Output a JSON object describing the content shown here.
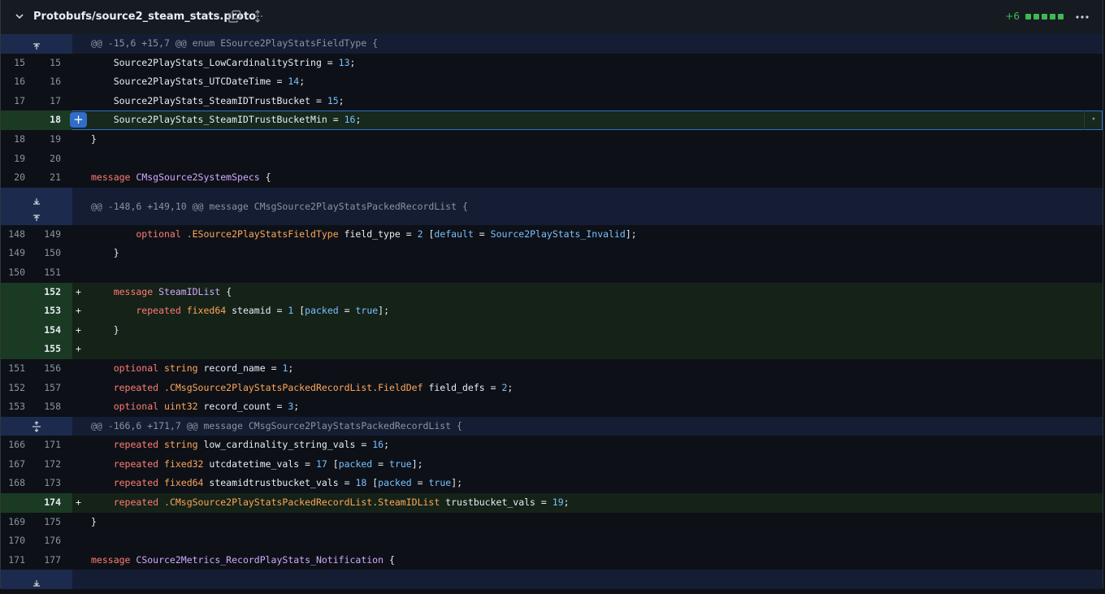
{
  "file": {
    "path": "Protobufs/source2_steam_stats.proto",
    "diffstat": {
      "additions": "+6",
      "blocks": 5
    }
  },
  "hunks": [
    "@@ -15,6 +15,7 @@ enum ESource2PlayStatsFieldType {",
    "@@ -148,6 +149,10 @@ message CMsgSource2PlayStatsPackedRecordList {",
    "@@ -166,6 +171,7 @@ message CMsgSource2PlayStatsPackedRecordList {"
  ],
  "lines": [
    {
      "old": "15",
      "new": "15",
      "tokens": [
        [
          "pl",
          "    Source2PlayStats_LowCardinalityString "
        ],
        [
          "pl",
          "= "
        ],
        [
          "num",
          "13"
        ],
        [
          "pl",
          ";"
        ]
      ]
    },
    {
      "old": "16",
      "new": "16",
      "tokens": [
        [
          "pl",
          "    Source2PlayStats_UTCDateTime "
        ],
        [
          "pl",
          "= "
        ],
        [
          "num",
          "14"
        ],
        [
          "pl",
          ";"
        ]
      ]
    },
    {
      "old": "17",
      "new": "17",
      "tokens": [
        [
          "pl",
          "    Source2PlayStats_SteamIDTrustBucket "
        ],
        [
          "pl",
          "= "
        ],
        [
          "num",
          "15"
        ],
        [
          "pl",
          ";"
        ]
      ]
    },
    {
      "old": "",
      "new": "18",
      "added": true,
      "tokens": [
        [
          "pl",
          "    Source2PlayStats_SteamIDTrustBucketMin "
        ],
        [
          "pl",
          "= "
        ],
        [
          "num",
          "16"
        ],
        [
          "pl",
          ";"
        ]
      ]
    },
    {
      "old": "18",
      "new": "19",
      "tokens": [
        [
          "pl",
          "}"
        ]
      ]
    },
    {
      "old": "19",
      "new": "20",
      "tokens": []
    },
    {
      "old": "20",
      "new": "21",
      "tokens": [
        [
          "kw",
          "message "
        ],
        [
          "nm",
          "CMsgSource2SystemSpecs"
        ],
        [
          "pl",
          " {"
        ]
      ]
    },
    {
      "old": "148",
      "new": "149",
      "tokens": [
        [
          "kw",
          "        optional "
        ],
        [
          "ty",
          ".ESource2PlayStatsFieldType "
        ],
        [
          "pl",
          "field_type "
        ],
        [
          "pl",
          "= "
        ],
        [
          "num",
          "2 "
        ],
        [
          "pl",
          "["
        ],
        [
          "at",
          "default "
        ],
        [
          "pl",
          "= "
        ],
        [
          "at",
          "Source2PlayStats_Invalid"
        ],
        [
          "pl",
          "];"
        ]
      ]
    },
    {
      "old": "149",
      "new": "150",
      "tokens": [
        [
          "pl",
          "    }"
        ]
      ]
    },
    {
      "old": "150",
      "new": "151",
      "tokens": []
    },
    {
      "old": "",
      "new": "152",
      "added": true,
      "sign": "+",
      "tokens": [
        [
          "kw",
          "    message "
        ],
        [
          "nm",
          "SteamIDList"
        ],
        [
          "pl",
          " {"
        ]
      ]
    },
    {
      "old": "",
      "new": "153",
      "added": true,
      "sign": "+",
      "tokens": [
        [
          "kw",
          "        repeated "
        ],
        [
          "ty",
          "fixed64 "
        ],
        [
          "pl",
          "steamid "
        ],
        [
          "pl",
          "= "
        ],
        [
          "num",
          "1 "
        ],
        [
          "pl",
          "["
        ],
        [
          "at",
          "packed "
        ],
        [
          "pl",
          "= "
        ],
        [
          "at",
          "true"
        ],
        [
          "pl",
          "];"
        ]
      ]
    },
    {
      "old": "",
      "new": "154",
      "added": true,
      "sign": "+",
      "tokens": [
        [
          "pl",
          "    }"
        ]
      ]
    },
    {
      "old": "",
      "new": "155",
      "added": true,
      "sign": "+",
      "tokens": []
    },
    {
      "old": "151",
      "new": "156",
      "tokens": [
        [
          "kw",
          "    optional "
        ],
        [
          "ty",
          "string "
        ],
        [
          "pl",
          "record_name "
        ],
        [
          "pl",
          "= "
        ],
        [
          "num",
          "1"
        ],
        [
          "pl",
          ";"
        ]
      ]
    },
    {
      "old": "152",
      "new": "157",
      "tokens": [
        [
          "kw",
          "    repeated "
        ],
        [
          "ty",
          ".CMsgSource2PlayStatsPackedRecordList.FieldDef "
        ],
        [
          "pl",
          "field_defs "
        ],
        [
          "pl",
          "= "
        ],
        [
          "num",
          "2"
        ],
        [
          "pl",
          ";"
        ]
      ]
    },
    {
      "old": "153",
      "new": "158",
      "tokens": [
        [
          "kw",
          "    optional "
        ],
        [
          "ty",
          "uint32 "
        ],
        [
          "pl",
          "record_count "
        ],
        [
          "pl",
          "= "
        ],
        [
          "num",
          "3"
        ],
        [
          "pl",
          ";"
        ]
      ]
    },
    {
      "old": "166",
      "new": "171",
      "tokens": [
        [
          "kw",
          "    repeated "
        ],
        [
          "ty",
          "string "
        ],
        [
          "pl",
          "low_cardinality_string_vals "
        ],
        [
          "pl",
          "= "
        ],
        [
          "num",
          "16"
        ],
        [
          "pl",
          ";"
        ]
      ]
    },
    {
      "old": "167",
      "new": "172",
      "tokens": [
        [
          "kw",
          "    repeated "
        ],
        [
          "ty",
          "fixed32 "
        ],
        [
          "pl",
          "utcdatetime_vals "
        ],
        [
          "pl",
          "= "
        ],
        [
          "num",
          "17 "
        ],
        [
          "pl",
          "["
        ],
        [
          "at",
          "packed "
        ],
        [
          "pl",
          "= "
        ],
        [
          "at",
          "true"
        ],
        [
          "pl",
          "];"
        ]
      ]
    },
    {
      "old": "168",
      "new": "173",
      "tokens": [
        [
          "kw",
          "    repeated "
        ],
        [
          "ty",
          "fixed64 "
        ],
        [
          "pl",
          "steamidtrustbucket_vals "
        ],
        [
          "pl",
          "= "
        ],
        [
          "num",
          "18 "
        ],
        [
          "pl",
          "["
        ],
        [
          "at",
          "packed "
        ],
        [
          "pl",
          "= "
        ],
        [
          "at",
          "true"
        ],
        [
          "pl",
          "];"
        ]
      ]
    },
    {
      "old": "",
      "new": "174",
      "added": true,
      "sign": "+",
      "tokens": [
        [
          "kw",
          "    repeated "
        ],
        [
          "ty",
          ".CMsgSource2PlayStatsPackedRecordList.SteamIDList "
        ],
        [
          "pl",
          "trustbucket_vals "
        ],
        [
          "pl",
          "= "
        ],
        [
          "num",
          "19"
        ],
        [
          "pl",
          ";"
        ]
      ]
    },
    {
      "old": "169",
      "new": "175",
      "tokens": [
        [
          "pl",
          "}"
        ]
      ]
    },
    {
      "old": "170",
      "new": "176",
      "tokens": []
    },
    {
      "old": "171",
      "new": "177",
      "tokens": [
        [
          "kw",
          "message "
        ],
        [
          "nm",
          "CSource2Metrics_RecordPlayStats_Notification"
        ],
        [
          "pl",
          " {"
        ]
      ]
    }
  ]
}
